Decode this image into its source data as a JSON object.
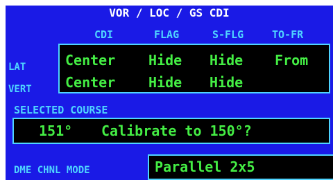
{
  "title": "VOR / LOC / GS CDI",
  "columns": [
    "CDI",
    "FLAG",
    "S-FLG",
    "TO-FR"
  ],
  "rows": [
    {
      "label": "LAT",
      "cells": [
        "Center",
        "Hide",
        "Hide",
        "From"
      ]
    },
    {
      "label": "VERT",
      "cells": [
        "Center",
        "Hide",
        "Hide",
        ""
      ]
    }
  ],
  "selected_course": {
    "label": "SELECTED COURSE",
    "value": "151°",
    "prompt": "Calibrate to 150°?"
  },
  "dme": {
    "label": "DME CHNL MODE",
    "value": "Parallel 2x5"
  },
  "colors": {
    "background": "#1a1ae6",
    "label": "#4fd4ff",
    "value": "#44ee44",
    "field": "#000000"
  }
}
